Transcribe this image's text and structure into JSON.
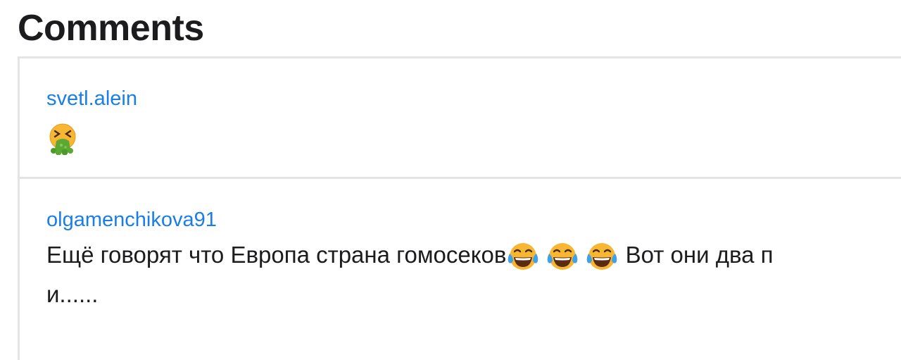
{
  "header": {
    "title": "Comments"
  },
  "comments": [
    {
      "author": "svetl.alein",
      "emojis": [
        "vomiting-face-emoji"
      ]
    },
    {
      "author": "olgamenchikova91",
      "text_before": "Ещё говорят что Европа страна гомосеков",
      "emojis": [
        "tears-of-joy-emoji",
        "tears-of-joy-emoji",
        "tears-of-joy-emoji"
      ],
      "text_after": " Вот они два п",
      "text_line2": "и......"
    }
  ],
  "colors": {
    "author_link": "#1a7ee8",
    "text": "#1c1c1e",
    "divider": "#e2e4e6"
  }
}
